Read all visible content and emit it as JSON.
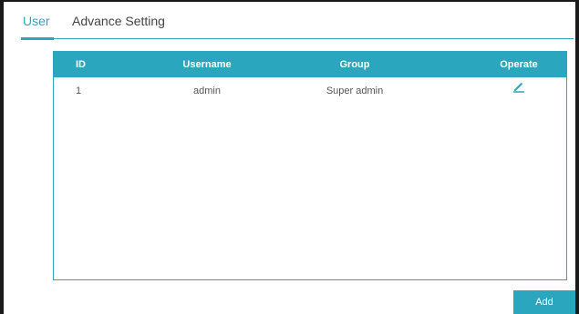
{
  "tabs": [
    {
      "label": "User",
      "active": true
    },
    {
      "label": "Advance Setting",
      "active": false
    }
  ],
  "table": {
    "headers": [
      "ID",
      "Username",
      "Group",
      "Operate"
    ],
    "rows": [
      {
        "id": "1",
        "username": "admin",
        "group": "Super admin",
        "operate_icon": "edit-icon"
      }
    ]
  },
  "buttons": {
    "add_label": "Add"
  },
  "colors": {
    "accent": "#2aa7bf",
    "text": "#555555",
    "frame": "#1a1a1a"
  }
}
